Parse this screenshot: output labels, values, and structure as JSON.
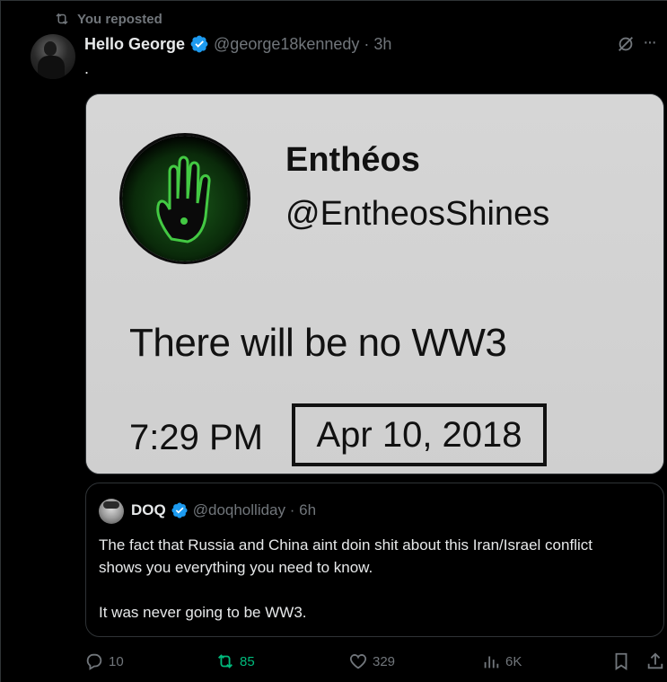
{
  "repost_banner": {
    "label": "You reposted"
  },
  "post": {
    "author_name": "Hello George",
    "handle_time": "@george18kennedy · 3h",
    "text": "."
  },
  "media": {
    "account_name": "Enthéos",
    "account_handle": "@EntheosShines",
    "tweet_text": "There will be no WW3",
    "time": "7:29 PM",
    "date": "Apr 10, 2018"
  },
  "quote": {
    "author_name": "DOQ",
    "handle_time": "@doqholliday · 6h",
    "line1": "The fact that Russia and China aint doin shit about this Iran/Israel conflict shows you everything you need to know.",
    "line2": "It was never going to be WW3."
  },
  "actions": {
    "replies": "10",
    "reposts": "85",
    "likes": "329",
    "views": "6K"
  },
  "colors": {
    "background": "#000000",
    "text": "#e7e9ea",
    "muted": "#71767b",
    "verified": "#1d9bf0",
    "repost_active": "#00ba7c",
    "border": "#2f3336"
  },
  "icons": [
    "repost-icon",
    "verified-badge-icon",
    "grok-icon",
    "more-icon",
    "reply-icon",
    "like-icon",
    "views-icon",
    "bookmark-icon",
    "share-icon"
  ]
}
